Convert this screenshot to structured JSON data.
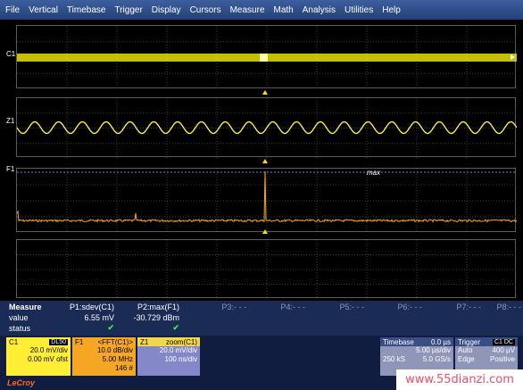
{
  "menu": [
    "File",
    "Vertical",
    "Timebase",
    "Trigger",
    "Display",
    "Cursors",
    "Measure",
    "Math",
    "Analysis",
    "Utilities",
    "Help"
  ],
  "traces": {
    "c1": {
      "label": "C1",
      "color": "#e8e000"
    },
    "z1": {
      "label": "Z1",
      "color": "#ffee33"
    },
    "f1": {
      "label": "F1",
      "color": "#f5a623"
    }
  },
  "f1_annotation": "max",
  "measure": {
    "title": "Measure",
    "row_value": "value",
    "row_status": "status",
    "params": [
      {
        "header": "P1:sdev(C1)",
        "value": "6.55 mV",
        "status": "✔",
        "active": true
      },
      {
        "header": "P2:max(F1)",
        "value": "-30.729 dBm",
        "status": "✔",
        "active": true
      },
      {
        "header": "P3:- - -",
        "value": "",
        "status": "",
        "active": false
      },
      {
        "header": "P4:- - -",
        "value": "",
        "status": "",
        "active": false
      },
      {
        "header": "P5:- - -",
        "value": "",
        "status": "",
        "active": false
      },
      {
        "header": "P6:- - -",
        "value": "",
        "status": "",
        "active": false
      },
      {
        "header": "P7:- - -",
        "value": "",
        "status": "",
        "active": false
      },
      {
        "header": "P8:- - -",
        "value": "",
        "status": "",
        "active": false
      }
    ]
  },
  "channel_c1": {
    "label": "C1",
    "tag": "DL50",
    "line1": "20.0 mV/div",
    "line2": "0.00 mV ofst"
  },
  "channel_f1": {
    "label": "F1",
    "func": "<FFT(C1)>",
    "line1": "10.0 dB/div",
    "line2": "5.00 MHz",
    "line3": "146 #"
  },
  "channel_z1": {
    "label": "Z1",
    "func": "zoom(C1)",
    "line1": "20.0 mV/div",
    "line2": "100 ns/div"
  },
  "timebase": {
    "label": "Timebase",
    "delay": "0.0 µs",
    "div": "5.00 µs/div",
    "samples": "250 kS",
    "rate": "5.0 GS/s"
  },
  "trigger": {
    "label": "Trigger",
    "tag": "C1 DC",
    "mode": "Auto",
    "level": "400 µV",
    "type": "Edge",
    "slope": "Positive"
  },
  "logo": "LeCroy",
  "watermark": "www.55dianzi.com"
}
